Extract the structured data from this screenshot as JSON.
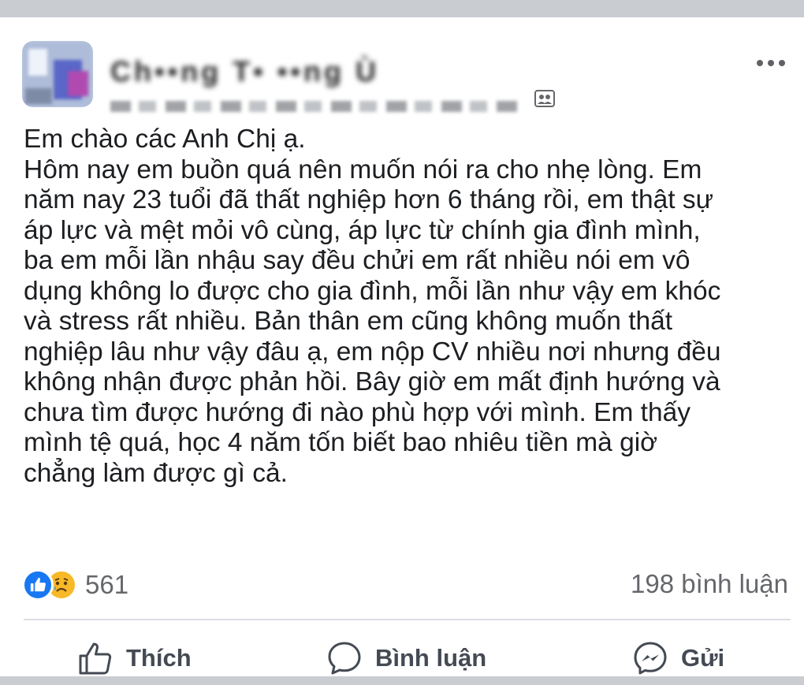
{
  "post": {
    "author_name": "Ch••ng T•  ••ng Ù",
    "body_lines": [
      "Em chào các Anh Chị ạ.",
      "Hôm nay em buồn quá nên muốn nói ra cho nhẹ lòng. Em",
      "năm nay 23 tuổi đã thất nghiệp hơn 6 tháng rồi, em thật sự",
      "áp lực và mệt mỏi vô cùng, áp lực từ chính gia đình mình,",
      "ba em mỗi lần nhậu say đều chửi em rất nhiều nói em vô",
      "dụng không lo được cho gia đình, mỗi lần như vậy em khóc",
      "và stress rất nhiều. Bản thân em cũng không muốn thất",
      "nghiệp lâu như vậy đâu ạ, em nộp CV nhiều nơi nhưng đều",
      "không nhận được phản hồi. Bây giờ em mất định hướng và",
      "chưa tìm được hướng đi nào phù hợp với mình. Em thấy",
      "mình tệ quá, học 4 năm tốn biết bao nhiêu tiền mà giờ",
      "chẳng làm được gì cả."
    ],
    "reaction_count": "561",
    "comment_count": "198 bình luận"
  },
  "actions": {
    "like_label": "Thích",
    "comment_label": "Bình luận",
    "send_label": "Gửi"
  },
  "icons": {
    "more": "more-options-icon",
    "audience": "group-audience-icon",
    "like": "thumbs-up-icon",
    "comment": "speech-bubble-icon",
    "send": "messenger-icon",
    "reaction_like": "like-reaction-icon",
    "reaction_sad": "sad-reaction-icon"
  },
  "colors": {
    "like_blue": "#1877f2",
    "sad_yellow": "#f7b928",
    "secondary_text": "#65676b"
  }
}
